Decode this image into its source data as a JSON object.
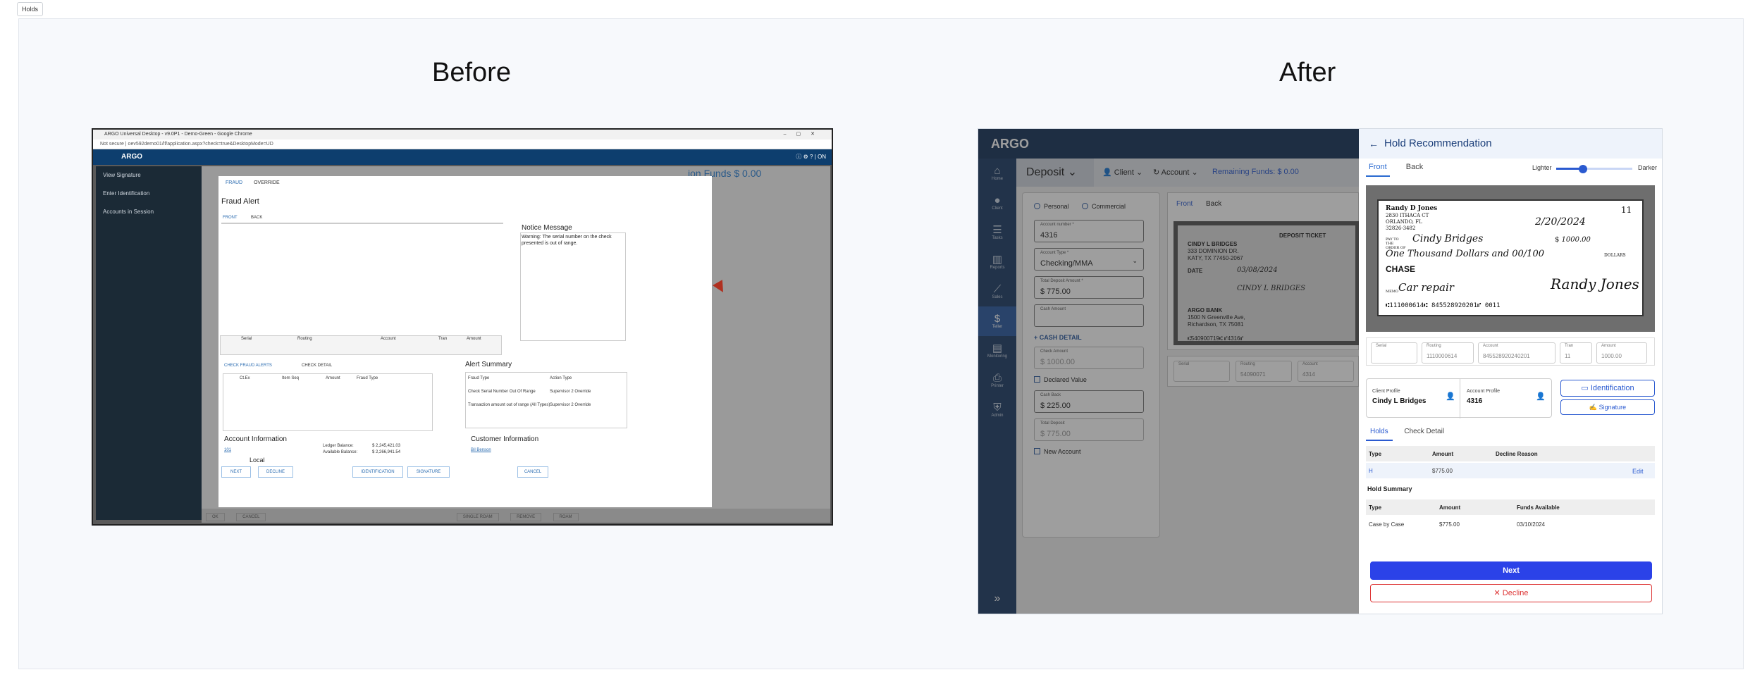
{
  "page": {
    "tab_label": "Holds",
    "before_label": "Before",
    "after_label": "After"
  },
  "legacy": {
    "window_title": "ARGO Universal Desktop - v9.0P1 - Demo-Green - Google Chrome",
    "url": "Not secure | oev592demo01/lf/application.aspx?check=true&DesktopMode=UD",
    "app_name": "ARGO",
    "side_items": [
      "View Signature",
      "Enter Identification",
      "Accounts in Session"
    ],
    "bg_funds": "ion Funds  $      0.00",
    "dialog": {
      "tabs": [
        "FRAUD",
        "OVERRIDE"
      ],
      "title": "Fraud Alert",
      "image_tabs": [
        "FRONT",
        "BACK"
      ],
      "notice_title": "Notice Message",
      "notice_text": "Warning: The serial number on the check presented is out of range.",
      "micr_cols": [
        "Serial",
        "Routing",
        "Account",
        "Tran",
        "Amount"
      ],
      "sub_tabs": [
        "CHECK FRAUD ALERTS",
        "CHECK DETAIL"
      ],
      "fraud_cols": [
        "Ct.Ex",
        "Item Seq",
        "Amount",
        "Fraud Type"
      ],
      "summary_title": "Alert Summary",
      "summary_cols": [
        "Fraud Type",
        "Action Type"
      ],
      "summary_rows": [
        {
          "type": "Check Serial Number Out Of Range",
          "action": "Supervisor 2 Override"
        },
        {
          "type": "Transaction amount out of range (All Types)",
          "action": "Supervisor 2 Override"
        }
      ],
      "account_info": "Account Information",
      "account_num": "101",
      "local": "Local",
      "ledger_label": "Ledger Balance:",
      "ledger": "$ 2,245,421.03",
      "available_label": "Available Balance:",
      "available": "$ 2,266,941.54",
      "customer_info": "Customer Information",
      "customer_name": "Bil Benson",
      "buttons": {
        "next": "NEXT",
        "decline": "DECLINE",
        "identification": "IDENTIFICATION",
        "signature": "SIGNATURE",
        "cancel": "CANCEL"
      }
    },
    "bottom_buttons": [
      "OK",
      "CANCEL",
      "SINGLE ROAM",
      "REMOVE",
      "ROAM"
    ]
  },
  "new": {
    "app_name": "ARGO",
    "rail": [
      "Home",
      "Client",
      "Tasks",
      "Reports",
      "Sales",
      "Teller",
      "Monitoring",
      "Printer",
      "Admin"
    ],
    "teller_glyph": "$",
    "expand": "»",
    "deposit_label": "Deposit",
    "client_label": "Client",
    "account_label": "Account",
    "remaining": "Remaining Funds: $ 0.00",
    "radio_personal": "Personal",
    "radio_commercial": "Commercial",
    "fields": [
      {
        "label": "Account number *",
        "value": "4316"
      },
      {
        "label": "Account Type *",
        "value": "Checking/MMA"
      },
      {
        "label": "Total Deposit Amount *",
        "value": "$ 775.00"
      },
      {
        "label": "Cash Amount",
        "value": ""
      }
    ],
    "cash_detail": "CASH DETAIL",
    "check_amount": {
      "label": "Check Amount",
      "value": "$ 1000.00"
    },
    "declared_value": "Declared Value",
    "cash_back": {
      "label": "Cash Back",
      "value": "$ 225.00"
    },
    "total_deposit": {
      "label": "Total Deposit",
      "value": "$ 775.00"
    },
    "new_account": "New Account",
    "ticket_tabs": [
      "Front",
      "Back"
    ],
    "ticket": {
      "title": "DEPOSIT TICKET",
      "name": "CINDY L BRIDGES",
      "addr1": "333 DOMINION DR.",
      "addr2": "KATY, TX 77450-2067",
      "date_label": "DATE",
      "date": "03/08/2024",
      "sign": "CINDY L BRIDGES",
      "bank": "ARGO BANK",
      "bank1": "1500 N Greenville Ave,",
      "bank2": "Richardson, TX 75081",
      "micr": "⑆540900719⑆   ⑈4316⑈"
    },
    "bottom_micr": [
      {
        "label": "Serial",
        "value": ""
      },
      {
        "label": "Routing",
        "value": "54090071"
      },
      {
        "label": "Account",
        "value": "4314"
      }
    ]
  },
  "panel": {
    "title": "Hold Recommendation",
    "tabs": [
      "Front",
      "Back"
    ],
    "lighter": "Lighter",
    "darker": "Darker",
    "brightness": 0.35,
    "check": {
      "payer": "Randy D Jones",
      "addr1": "2830 ITHACA CT",
      "addr2": "ORLANDO, FL",
      "addr3": "32826-3482",
      "number": "11",
      "date": "2/20/2024",
      "payto_label": "PAY TO THE ORDER OF",
      "payee": "Cindy Bridges",
      "amount": "1000.00",
      "words": "One Thousand Dollars and 00/100",
      "dollars": "DOLLARS",
      "bank": "CHASE",
      "memo_label": "MEMO",
      "memo": "Car repair",
      "signature": "Randy Jones",
      "micr": "⑆111000614⑆  845528920201⑈  0011"
    },
    "micr_fields": [
      {
        "label": "Serial",
        "value": ""
      },
      {
        "label": "Routing",
        "value": "1110000614"
      },
      {
        "label": "Account",
        "value": "845528920240201"
      },
      {
        "label": "Tran",
        "value": "11"
      },
      {
        "label": "Amount",
        "value": "1000.00"
      }
    ],
    "client_profile_label": "Client Profile",
    "client_profile": "Cindy L Bridges",
    "account_profile_label": "Account Profile",
    "account_profile": "4316",
    "identification": "Identification",
    "signature": "Signature",
    "hold_tabs": [
      "Holds",
      "Check Detail"
    ],
    "holds_cols": [
      "Type",
      "Amount",
      "Decline Reason"
    ],
    "holds_rows": [
      {
        "type": "H",
        "amount": "$775.00",
        "reason": "",
        "action": "Edit"
      }
    ],
    "summary_title": "Hold Summary",
    "summary_cols": [
      "Type",
      "Amount",
      "Funds Available"
    ],
    "summary_rows": [
      {
        "type": "Case by Case",
        "amount": "$775.00",
        "funds": "03/10/2024"
      }
    ],
    "next": "Next",
    "decline": "Decline",
    "colors": {
      "primary": "#2b42e8",
      "danger": "#dd3333",
      "navy": "#17335a"
    }
  }
}
